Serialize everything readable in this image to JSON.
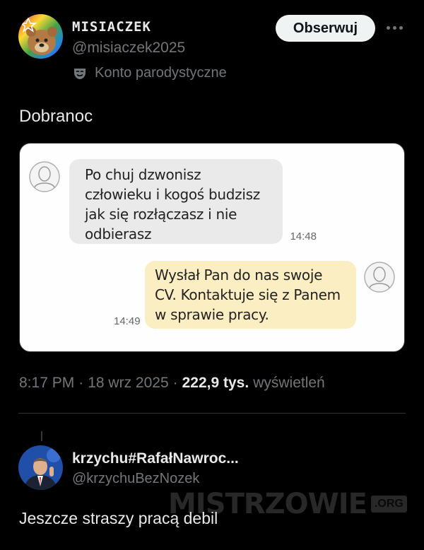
{
  "tweet": {
    "display_name": "MISIACZEK",
    "handle": "@misiaczek2025",
    "parody_label": "Konto parodystyczne",
    "follow_label": "Obserwuj",
    "text": "Dobranoc",
    "time": "8:17 PM",
    "date": "18 wrz 2025",
    "views_count": "222,9 tys.",
    "views_label": "wyświetleń"
  },
  "chat": {
    "incoming": {
      "lines": [
        "Po chuj dzwonisz",
        "człowieku i kogoś budzisz",
        "jak się rozłączasz i nie",
        "odbierasz"
      ],
      "time": "14:48"
    },
    "outgoing": {
      "lines": [
        "Wysłał Pan do nas swoje",
        "CV. Kontaktuje się z Panem",
        "w sprawie pracy."
      ],
      "time": "14:49"
    }
  },
  "reply": {
    "display_name": "krzychu#RafałNawroc...",
    "handle": "@krzychuBezNozek",
    "text": "Jeszcze straszy pracą debil"
  },
  "watermark": {
    "main": "MISTRZOWIE",
    "suffix": ".ORG"
  },
  "icons": {
    "more": "more-horizontal-icon",
    "parody": "parody-mask-icon",
    "chat_avatar": "person-silhouette-icon"
  },
  "colors": {
    "background": "#000000",
    "text_primary": "#e7e9ea",
    "text_secondary": "#71767b",
    "follow_button": "#eff3f4",
    "incoming_bubble": "#eaeaea",
    "outgoing_bubble": "#fbeec2"
  }
}
